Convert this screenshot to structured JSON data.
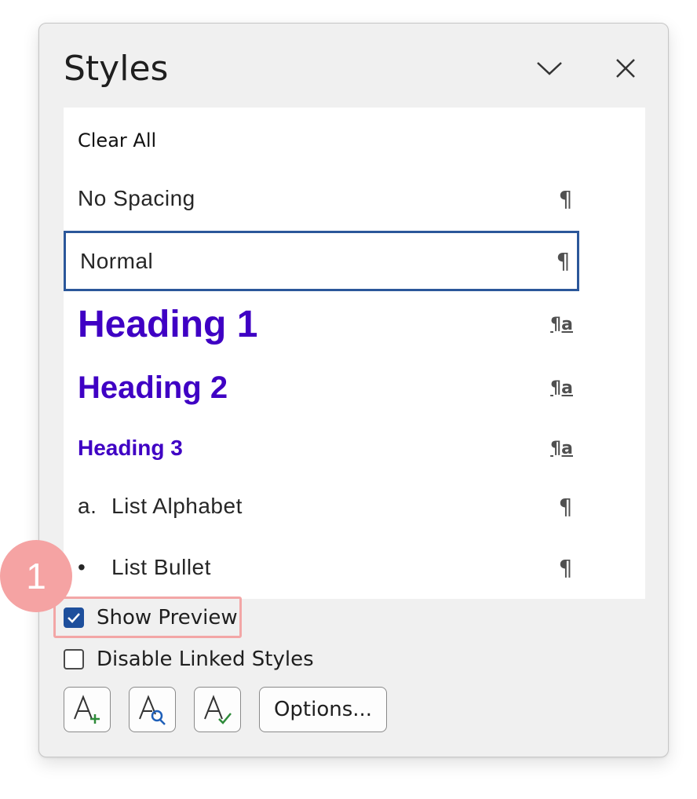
{
  "pane": {
    "title": "Styles",
    "chevron_icon": "chevron-down-icon",
    "close_icon": "close-icon"
  },
  "styles": [
    {
      "label": "Clear All",
      "mark": ""
    },
    {
      "label": "No Spacing",
      "mark": "¶"
    },
    {
      "label": "Normal",
      "mark": "¶",
      "selected": true
    },
    {
      "label": "Heading 1",
      "mark": "¶a"
    },
    {
      "label": "Heading 2",
      "mark": "¶a"
    },
    {
      "label": "Heading 3",
      "mark": "¶a"
    },
    {
      "prefix": "a.",
      "label": "List Alphabet",
      "mark": "¶"
    },
    {
      "prefix": "•",
      "label": "List Bullet",
      "mark": "¶"
    }
  ],
  "options": {
    "show_preview": {
      "label": "Show Preview",
      "checked": true
    },
    "disable_linked": {
      "label": "Disable Linked Styles",
      "checked": false
    }
  },
  "toolbar": {
    "new_style_icon": "new-style-icon",
    "style_inspector_icon": "style-inspector-icon",
    "manage_styles_icon": "manage-styles-icon",
    "options_label": "Options..."
  },
  "callout": {
    "number": "1"
  },
  "colors": {
    "heading": "#3f00c4",
    "selection_border": "#2b579a",
    "checkbox": "#1e4f9c",
    "callout": "#f5a3a3"
  }
}
